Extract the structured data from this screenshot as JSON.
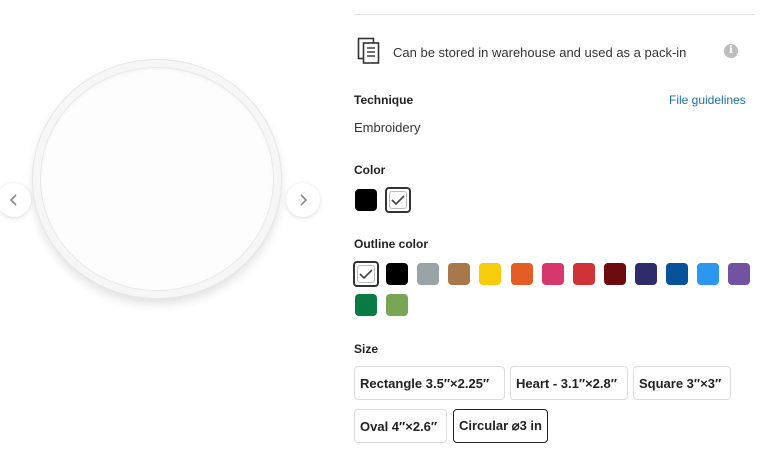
{
  "gallery": {
    "prev_icon": "chevron-left-icon",
    "next_icon": "chevron-right-icon"
  },
  "info": {
    "icon": "document-stack-icon",
    "text": "Can be stored in warehouse and used as a pack-in",
    "info_icon": "i"
  },
  "technique": {
    "label": "Technique",
    "value": "Embroidery",
    "guidelines_link": "File guidelines"
  },
  "color": {
    "label": "Color",
    "options": [
      {
        "name": "Black",
        "hex": "#000000",
        "selected": false
      },
      {
        "name": "White",
        "hex": "#ffffff",
        "selected": true
      }
    ]
  },
  "outline": {
    "label": "Outline color",
    "options": [
      {
        "name": "White",
        "hex": "#ffffff",
        "selected": true
      },
      {
        "name": "Black",
        "hex": "#000000"
      },
      {
        "name": "Grey",
        "hex": "#9aa3a8"
      },
      {
        "name": "Tan",
        "hex": "#a9784a"
      },
      {
        "name": "Yellow",
        "hex": "#f7cc0a"
      },
      {
        "name": "Orange",
        "hex": "#e35d24"
      },
      {
        "name": "Pink",
        "hex": "#d6376c"
      },
      {
        "name": "Red",
        "hex": "#d13237"
      },
      {
        "name": "Maroon",
        "hex": "#6c0a0d"
      },
      {
        "name": "Navy",
        "hex": "#2f2d69"
      },
      {
        "name": "Royal Blue",
        "hex": "#07539b"
      },
      {
        "name": "Light Blue",
        "hex": "#2d96ef"
      },
      {
        "name": "Purple",
        "hex": "#7252a1"
      },
      {
        "name": "Green",
        "hex": "#087a44"
      },
      {
        "name": "Olive",
        "hex": "#79a654"
      }
    ]
  },
  "size": {
    "label": "Size",
    "options": [
      {
        "label": "Rectangle 3.5″×2.25″",
        "selected": false
      },
      {
        "label": "Heart - 3.1″×2.8″",
        "selected": false
      },
      {
        "label": "Square 3″×3″",
        "selected": false
      },
      {
        "label": "Oval 4″×2.6″",
        "selected": false
      },
      {
        "label": "Circular ⌀3 in",
        "selected": true
      }
    ]
  }
}
